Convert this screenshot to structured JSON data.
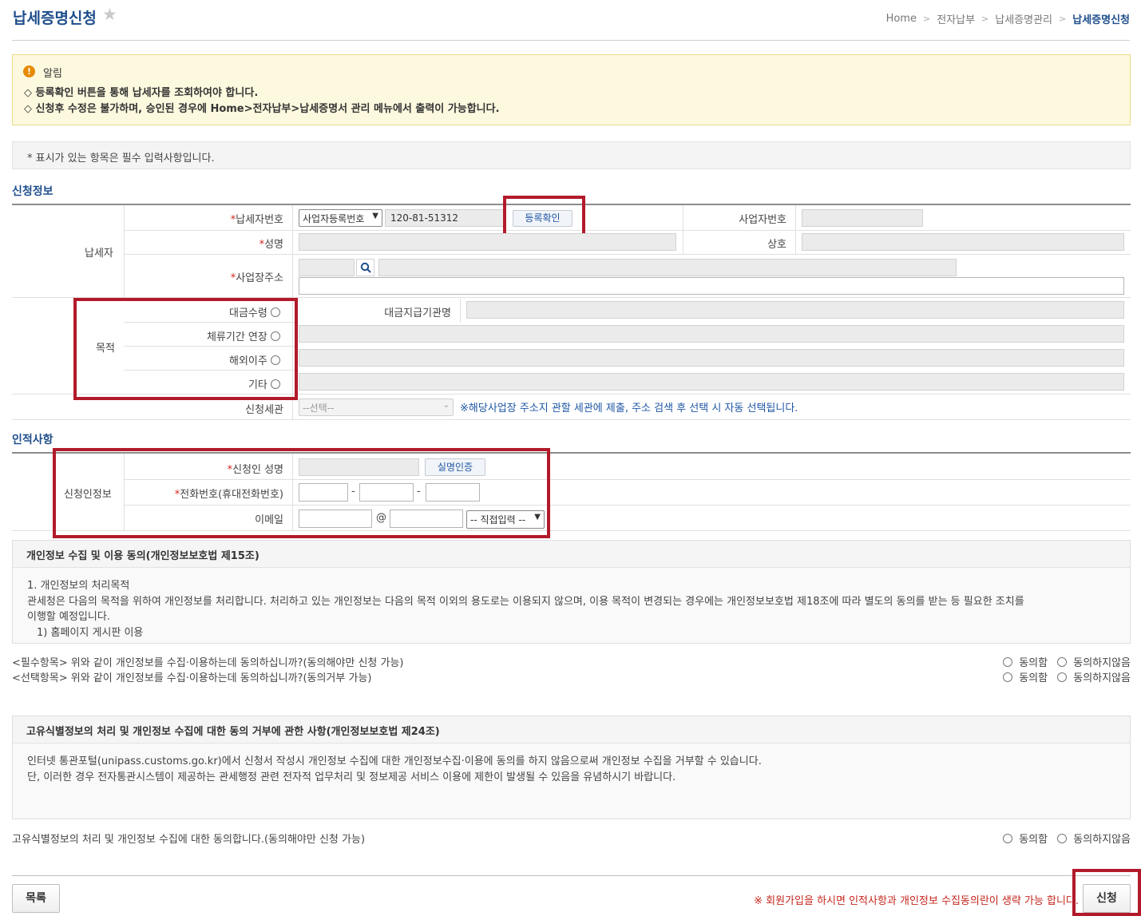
{
  "header": {
    "title": "납세증명신청",
    "star": "★",
    "breadcrumb": [
      "Home",
      "전자납부",
      "납세증명관리",
      "납세증명신청"
    ],
    "sep": ">"
  },
  "notice": {
    "icon": "!",
    "title": "알림",
    "lines": [
      "◇ 등록확인 버튼을 통해 납세자를 조회하여야 합니다.",
      "◇ 신청후 수정은 불가하며, 승인된 경우에 Home>전자납부>납세증명서 관리 메뉴에서 출력이 가능합니다."
    ]
  },
  "required_note": "* 표시가 있는 항목은 필수 입력사항입니다.",
  "application": {
    "section_title": "신청정보",
    "taxpayer_group": "납세자",
    "req_mark": "*",
    "taxpayer_no_label": "납세자번호",
    "id_type": "사업자등록번호",
    "taxpayer_no_value": "120-81-51312",
    "check_button": "등록확인",
    "biz_no_label": "사업자번호",
    "name_label": "성명",
    "company_label": "상호",
    "address_label": "사업장주소",
    "purpose_group": "목적",
    "purposes": [
      "대금수령",
      "체류기간 연장",
      "해외이주",
      "기타"
    ],
    "payer_org_label": "대금지급기관명",
    "customs_label": "신청세관",
    "customs_select": "--선택--",
    "customs_hint": "※해당사업장 주소지 관할 세관에 제출, 주소 검색 후 선택 시 자동 선택됩니다."
  },
  "personal": {
    "section_title": "인적사항",
    "group": "신청인정보",
    "name_label": "신청인 성명",
    "verify_button": "실명인증",
    "phone_label": "전화번호(휴대전화번호)",
    "dash": "-",
    "email_label": "이메일",
    "at": "@",
    "domain_select": "-- 직접입력 --"
  },
  "consent1": {
    "title": "개인정보 수집 및 이용 동의(개인정보보호법 제15조)",
    "lines": [
      "1. 개인정보의 처리목적",
      "관세청은 다음의 목적을 위하여 개인정보를 처리합니다. 처리하고 있는 개인정보는 다음의 목적 이외의 용도로는 이용되지 않으며, 이용 목적이 변경되는 경우에는 개인정보보호법 제18조에 따라 별도의 동의를 받는 등 필요한 조치를",
      "이행할 예정입니다.",
      "1) 홈페이지 게시판 이용"
    ],
    "q_required": "<필수항목> 위와 같이 개인정보를 수집·이용하는데 동의하십니까?(동의해야만 신청 가능)",
    "q_optional": "<선택항목> 위와 같이 개인정보를 수집·이용하는데 동의하십니까?(동의거부 가능)"
  },
  "consent2": {
    "title": "고유식별정보의 처리 및 개인정보 수집에 대한 동의 거부에 관한 사항(개인정보보호법 제24조)",
    "lines": [
      "인터넷 통관포털(unipass.customs.go.kr)에서 신청서 작성시 개인정보 수집에 대한 개인정보수집·이용에 동의를 하지 않음으로써 개인정보 수집을 거부할 수 있습니다.",
      "단, 이러한 경우 전자통관시스템이 제공하는 관세행정 관련 전자적 업무처리 및 정보제공 서비스 이용에 제한이 발생될 수 있음을 유념하시기 바랍니다."
    ],
    "question": "고유식별정보의 처리 및 개인정보 수집에 대한 동의합니다.(동의해야만 신청 가능)"
  },
  "options": {
    "agree": "동의함",
    "disagree": "동의하지않음"
  },
  "footer": {
    "list_button": "목록",
    "note": "※ 회원가입을 하시면 인적사항과 개인정보 수집동의란이 생략 가능 합니다.",
    "apply_button": "신청"
  },
  "colors": {
    "title": "#1f4e8c",
    "highlight": "#b21a2a",
    "notice_bg": "#fdf9df"
  }
}
